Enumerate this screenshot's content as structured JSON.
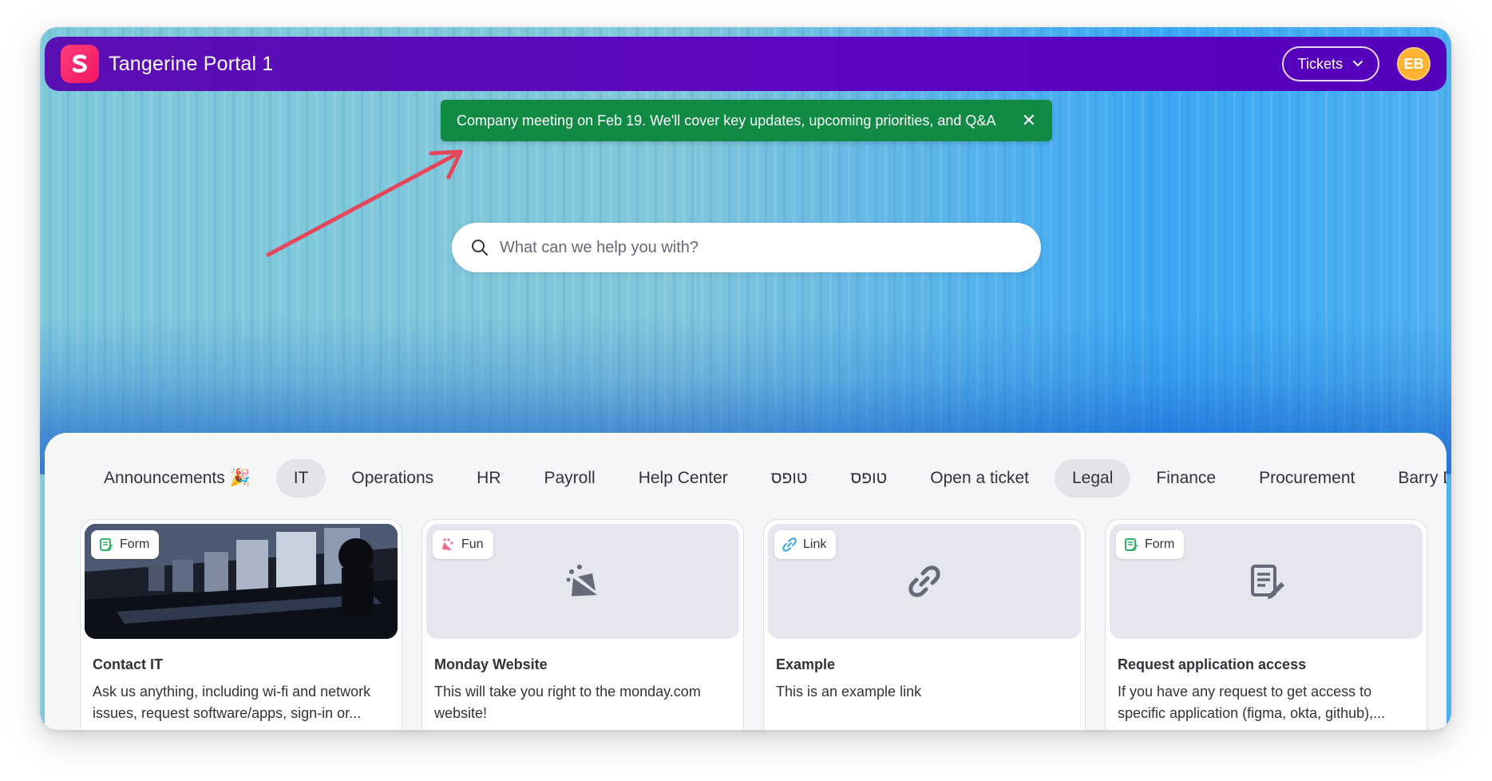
{
  "header": {
    "app_title": "Tangerine Portal 1",
    "tickets_label": "Tickets",
    "avatar_initials": "EB",
    "brand_color": "#5c06c2",
    "logo_color": "#f21563"
  },
  "banner": {
    "message": "Company meeting on Feb 19. We'll cover key updates, upcoming priorities, and Q&A",
    "close_glyph": "✕",
    "color": "#118a45"
  },
  "search": {
    "placeholder": "What can we help you with?"
  },
  "tabs": [
    {
      "label": "Announcements 🎉",
      "active": false
    },
    {
      "label": "IT",
      "active": true
    },
    {
      "label": "Operations",
      "active": false
    },
    {
      "label": "HR",
      "active": false
    },
    {
      "label": "Payroll",
      "active": false
    },
    {
      "label": "Help Center",
      "active": false
    },
    {
      "label": "טופס",
      "active": false
    },
    {
      "label": "טופס",
      "active": false
    },
    {
      "label": "Open a ticket",
      "active": false
    },
    {
      "label": "Legal",
      "active": true
    },
    {
      "label": "Finance",
      "active": false
    },
    {
      "label": "Procurement",
      "active": false
    },
    {
      "label": "Barry De",
      "active": false
    }
  ],
  "cards": [
    {
      "badge": "Form",
      "badge_icon": "form-icon",
      "media_icon": "photo",
      "title": "Contact IT",
      "description": "Ask us anything, including wi-fi and network issues, request software/apps, sign-in or..."
    },
    {
      "badge": "Fun",
      "badge_icon": "party-icon",
      "media_icon": "party-popper-icon",
      "title": "Monday Website",
      "description": "This will take you right to the monday.com website!"
    },
    {
      "badge": "Link",
      "badge_icon": "link-icon",
      "media_icon": "link-icon",
      "title": "Example",
      "description": "This is an example link"
    },
    {
      "badge": "Form",
      "badge_icon": "form-icon",
      "media_icon": "form-edit-icon",
      "title": "Request application access",
      "description": "If you have any request to get access to specific application (figma, okta, github),..."
    }
  ]
}
